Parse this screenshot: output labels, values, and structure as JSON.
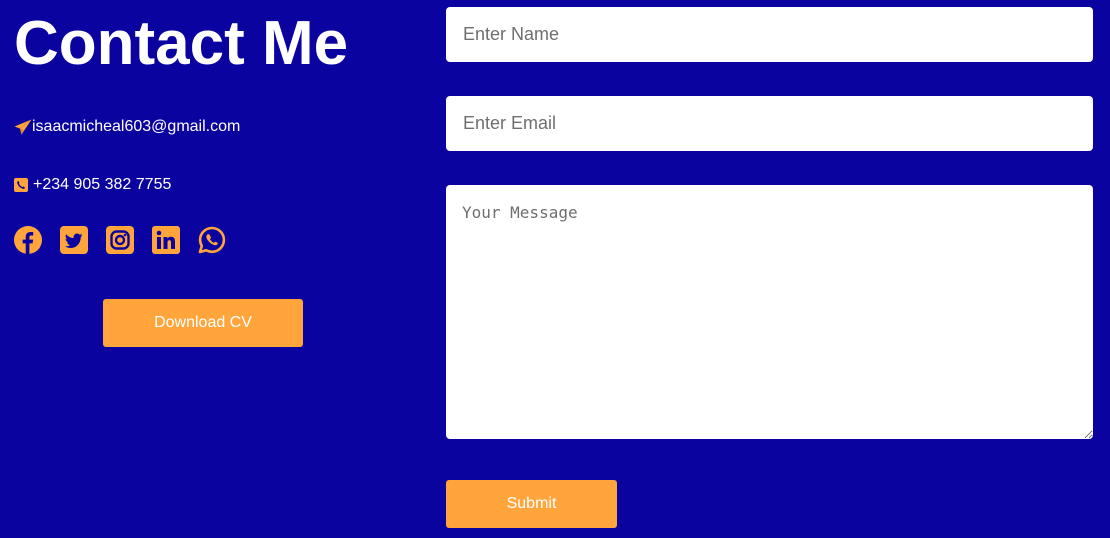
{
  "contact": {
    "title": "Contact Me",
    "email": "isaacmicheal603@gmail.com",
    "phone": "+234 905 382 7755",
    "socials": [
      "facebook-icon",
      "twitter-icon",
      "instagram-icon",
      "linkedin-icon",
      "whatsapp-icon"
    ],
    "download_label": "Download CV"
  },
  "form": {
    "name_placeholder": "Enter Name",
    "email_placeholder": "Enter Email",
    "message_placeholder": "Your Message",
    "submit_label": "Submit"
  },
  "colors": {
    "background": "#0b039f",
    "accent": "#ffa53c",
    "text": "#ffffff"
  }
}
